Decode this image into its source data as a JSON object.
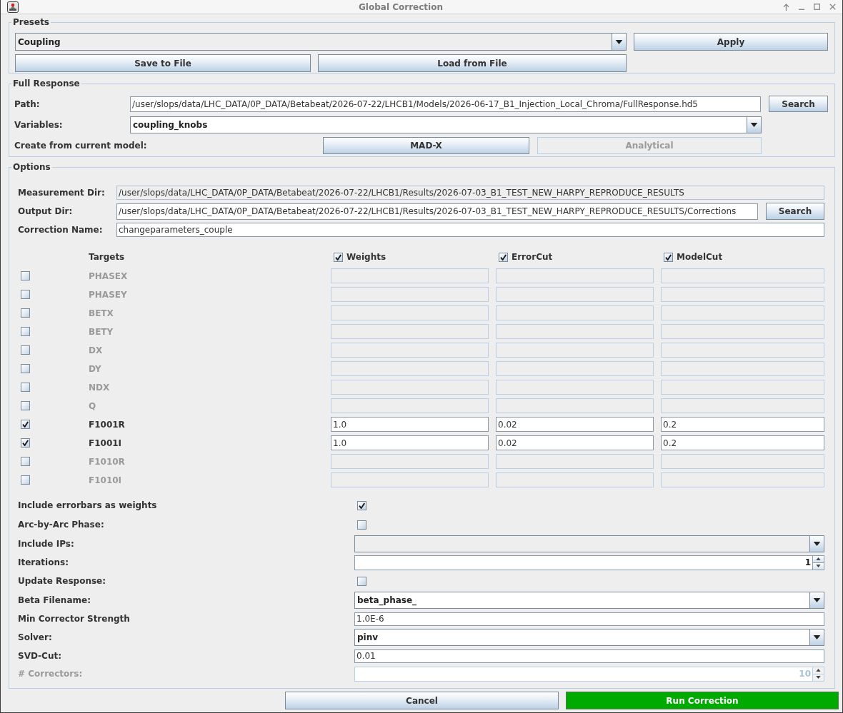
{
  "window": {
    "title": "Global Correction"
  },
  "presets": {
    "title": "Presets",
    "preset": {
      "value": "Coupling",
      "editable": false
    },
    "apply_button": "Apply",
    "save_button": "Save to File",
    "load_button": "Load from File"
  },
  "full_response": {
    "title": "Full Response",
    "path": {
      "label": "Path:",
      "value": "/user/slops/data/LHC_DATA/0P_DATA/Betabeat/2026-07-22/LHCB1/Models/2026-06-17_B1_Injection_Local_Chroma/FullResponse.hd5",
      "button": "Search"
    },
    "variables": {
      "label": "Variables:",
      "value": "coupling_knobs",
      "editable": true
    },
    "create_from_model": {
      "label": "Create from current model:",
      "buttons": [
        {
          "label": "MAD-X",
          "disabled": false
        },
        {
          "label": "Analytical",
          "disabled": true
        }
      ]
    }
  },
  "options": {
    "title": "Options",
    "fields": [
      {
        "label": "Measurement Dir:",
        "value": "/user/slops/data/LHC_DATA/0P_DATA/Betabeat/2026-07-22/LHCB1/Results/2026-07-03_B1_TEST_NEW_HARPY_REPRODUCE_RESULTS",
        "editable": false
      },
      {
        "label": "Output Dir:",
        "value": "/user/slops/data/LHC_DATA/0P_DATA/Betabeat/2026-07-22/LHCB1/Results/2026-07-03_B1_TEST_NEW_HARPY_REPRODUCE_RESULTS/Corrections",
        "editable": true,
        "button": "Search"
      },
      {
        "label": "Correction Name:",
        "value": "changeparameters_couple",
        "editable": true
      }
    ],
    "targets": {
      "title": "Targets",
      "columns": [
        {
          "label": "Weights",
          "checked": true
        },
        {
          "label": "ErrorCut",
          "checked": true
        },
        {
          "label": "ModelCut",
          "checked": true
        }
      ],
      "rows": [
        {
          "name": "PHASEX",
          "checked": false
        },
        {
          "name": "PHASEY",
          "checked": false
        },
        {
          "name": "BETX",
          "checked": false
        },
        {
          "name": "BETY",
          "checked": false
        },
        {
          "name": "DX",
          "checked": false
        },
        {
          "name": "DY",
          "checked": false
        },
        {
          "name": "NDX",
          "checked": false
        },
        {
          "name": "Q",
          "checked": false
        },
        {
          "name": "F1001R",
          "checked": true,
          "values": [
            "1.0",
            "0.02",
            "0.2"
          ]
        },
        {
          "name": "F1001I",
          "checked": true,
          "values": [
            "1.0",
            "0.02",
            "0.2"
          ]
        },
        {
          "name": "F1010R",
          "checked": false
        },
        {
          "name": "F1010I",
          "checked": false
        }
      ]
    },
    "settings": [
      {
        "kind": "checkbox",
        "label": "Include errorbars as weights",
        "checked": true,
        "disabled": false
      },
      {
        "kind": "checkbox",
        "label": "Arc-by-Arc Phase:",
        "checked": false,
        "disabled": false
      },
      {
        "kind": "dropdown",
        "label": "Include IPs:",
        "editable": false,
        "disabled": false
      },
      {
        "kind": "spinner",
        "label": "Iterations:",
        "value": "1",
        "disabled": false
      },
      {
        "kind": "checkbox",
        "label": "Update Response:",
        "checked": false,
        "disabled": false
      },
      {
        "kind": "dropdown",
        "label": "Beta Filename:",
        "value": "beta_phase_",
        "editable": true,
        "disabled": false
      },
      {
        "kind": "field",
        "label": "Min Corrector Strength",
        "value": "1.0E-6",
        "disabled": false
      },
      {
        "kind": "dropdown",
        "label": "Solver:",
        "value": "pinv",
        "editable": true,
        "disabled": false
      },
      {
        "kind": "field",
        "label": "SVD-Cut:",
        "value": "0.01",
        "disabled": false
      },
      {
        "kind": "spinner",
        "label": "# Correctors:",
        "value": "10",
        "disabled": true
      }
    ]
  },
  "footer": {
    "buttons": [
      {
        "label": "Cancel",
        "kind": "secondary"
      },
      {
        "label": "Run Correction",
        "kind": "primary"
      }
    ]
  }
}
